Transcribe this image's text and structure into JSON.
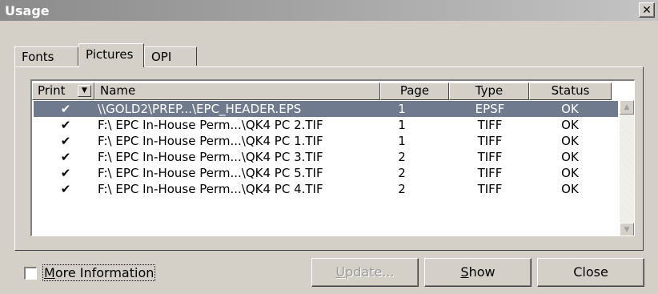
{
  "window": {
    "title": "Usage",
    "close_glyph": "✕"
  },
  "tabs": [
    {
      "label": "Fonts",
      "active": false
    },
    {
      "label": "Pictures",
      "active": true
    },
    {
      "label": "OPI",
      "active": false
    }
  ],
  "table": {
    "columns": [
      "Print",
      "Name",
      "Page",
      "Type",
      "Status"
    ],
    "rows": [
      {
        "print": "✔",
        "name": "\\\\GOLD2\\PREP...\\EPC_HEADER.EPS",
        "page": "1",
        "type": "EPSF",
        "status": "OK",
        "selected": true
      },
      {
        "print": "✔",
        "name": "F:\\ EPC In-House Perm...\\QK4 PC 2.TIF",
        "page": "1",
        "type": "TIFF",
        "status": "OK",
        "selected": false
      },
      {
        "print": "✔",
        "name": "F:\\ EPC In-House Perm...\\QK4 PC 1.TIF",
        "page": "1",
        "type": "TIFF",
        "status": "OK",
        "selected": false
      },
      {
        "print": "✔",
        "name": "F:\\ EPC In-House Perm...\\QK4 PC 3.TIF",
        "page": "2",
        "type": "TIFF",
        "status": "OK",
        "selected": false
      },
      {
        "print": "✔",
        "name": "F:\\ EPC In-House Perm...\\QK4 PC 5.TIF",
        "page": "2",
        "type": "TIFF",
        "status": "OK",
        "selected": false
      },
      {
        "print": "✔",
        "name": "F:\\ EPC In-House Perm...\\QK4 PC 4.TIF",
        "page": "2",
        "type": "TIFF",
        "status": "OK",
        "selected": false
      }
    ]
  },
  "more_information": {
    "label_first": "M",
    "label_rest": "ore Information",
    "checked": false
  },
  "buttons": {
    "update": {
      "first": "U",
      "rest": "pdate...",
      "enabled": false
    },
    "show": {
      "first": "S",
      "rest": "how",
      "enabled": true
    },
    "close": {
      "label": "Close",
      "enabled": true
    }
  },
  "colors": {
    "selection": "#6f7a8e",
    "face": "#d4d0c8"
  }
}
